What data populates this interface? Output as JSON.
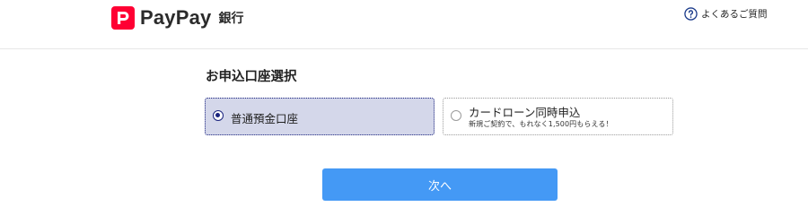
{
  "header": {
    "brand_name": "PayPay",
    "brand_sub": "銀行",
    "brand_color": "#ff0033",
    "faq_label": "よくあるご質問",
    "faq_icon": "question-circle-icon"
  },
  "main": {
    "section_title": "お申込口座選択",
    "options": [
      {
        "label": "普通預金口座",
        "selected": true
      },
      {
        "label": "カードローン同時申込",
        "sub_label": "新規ご契約で、もれなく1,500円もらえる！",
        "selected": false
      }
    ],
    "next_button_label": "次へ"
  },
  "colors": {
    "selected_bg": "#d4d7ea",
    "selected_border": "#1a237e",
    "button_bg": "#4499f5"
  }
}
